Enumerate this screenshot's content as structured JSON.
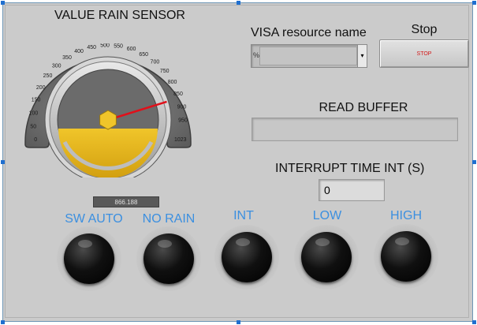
{
  "gauge": {
    "title": "VALUE RAIN SENSOR",
    "ticks": [
      "0",
      "50",
      "100",
      "150",
      "200",
      "250",
      "300",
      "350",
      "400",
      "450",
      "500",
      "550",
      "600",
      "650",
      "700",
      "750",
      "800",
      "850",
      "900",
      "950",
      "1023"
    ],
    "min": 0,
    "max": 1023,
    "value": 866.188,
    "digital_display": "866.188",
    "needle_color": "#e0101a",
    "fill_color": "#e8b81c"
  },
  "visa": {
    "label": "VISA resource name",
    "prefix": "%",
    "value": ""
  },
  "stop": {
    "label": "Stop",
    "button_text": "STOP"
  },
  "read_buffer": {
    "label": "READ BUFFER",
    "value": ""
  },
  "interrupt": {
    "label": "INTERRUPT TIME INT (S)",
    "value": "0"
  },
  "indicators": [
    {
      "label": "SW AUTO",
      "state": "off"
    },
    {
      "label": "NO RAIN",
      "state": "off"
    },
    {
      "label": "INT",
      "state": "off"
    },
    {
      "label": "LOW",
      "state": "off"
    },
    {
      "label": "HIGH",
      "state": "off"
    }
  ],
  "colors": {
    "panel": "#cbcbcb",
    "indicator_label": "#3b8fe0",
    "stop_text": "#d21a1a"
  }
}
